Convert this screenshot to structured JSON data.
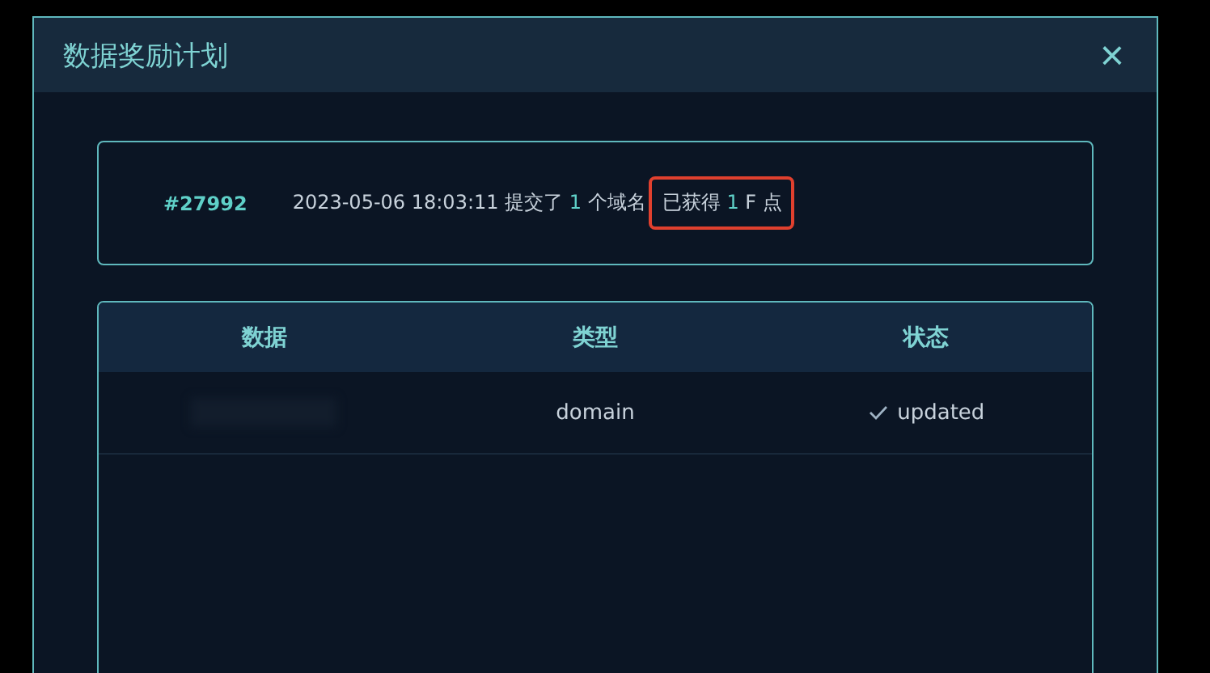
{
  "dialog": {
    "title": "数据奖励计划",
    "close": "×"
  },
  "record": {
    "id": "#27992",
    "message": [
      {
        "text": "2023-05-06 18:03:11 提交了 ",
        "accent": false
      },
      {
        "text": "1",
        "accent": true
      },
      {
        "text": " 个域名",
        "accent": false
      }
    ],
    "reward": {
      "highlighted": true,
      "parts": [
        {
          "text": "已获得 ",
          "accent": false
        },
        {
          "text": "1",
          "accent": true
        },
        {
          "text": " F 点",
          "accent": false
        }
      ]
    }
  },
  "table": {
    "columns": [
      "数据",
      "类型",
      "状态"
    ],
    "rows": [
      {
        "data": {
          "kind": "redacted"
        },
        "type": "domain",
        "status": {
          "text": "updated",
          "done": true
        }
      }
    ]
  }
}
